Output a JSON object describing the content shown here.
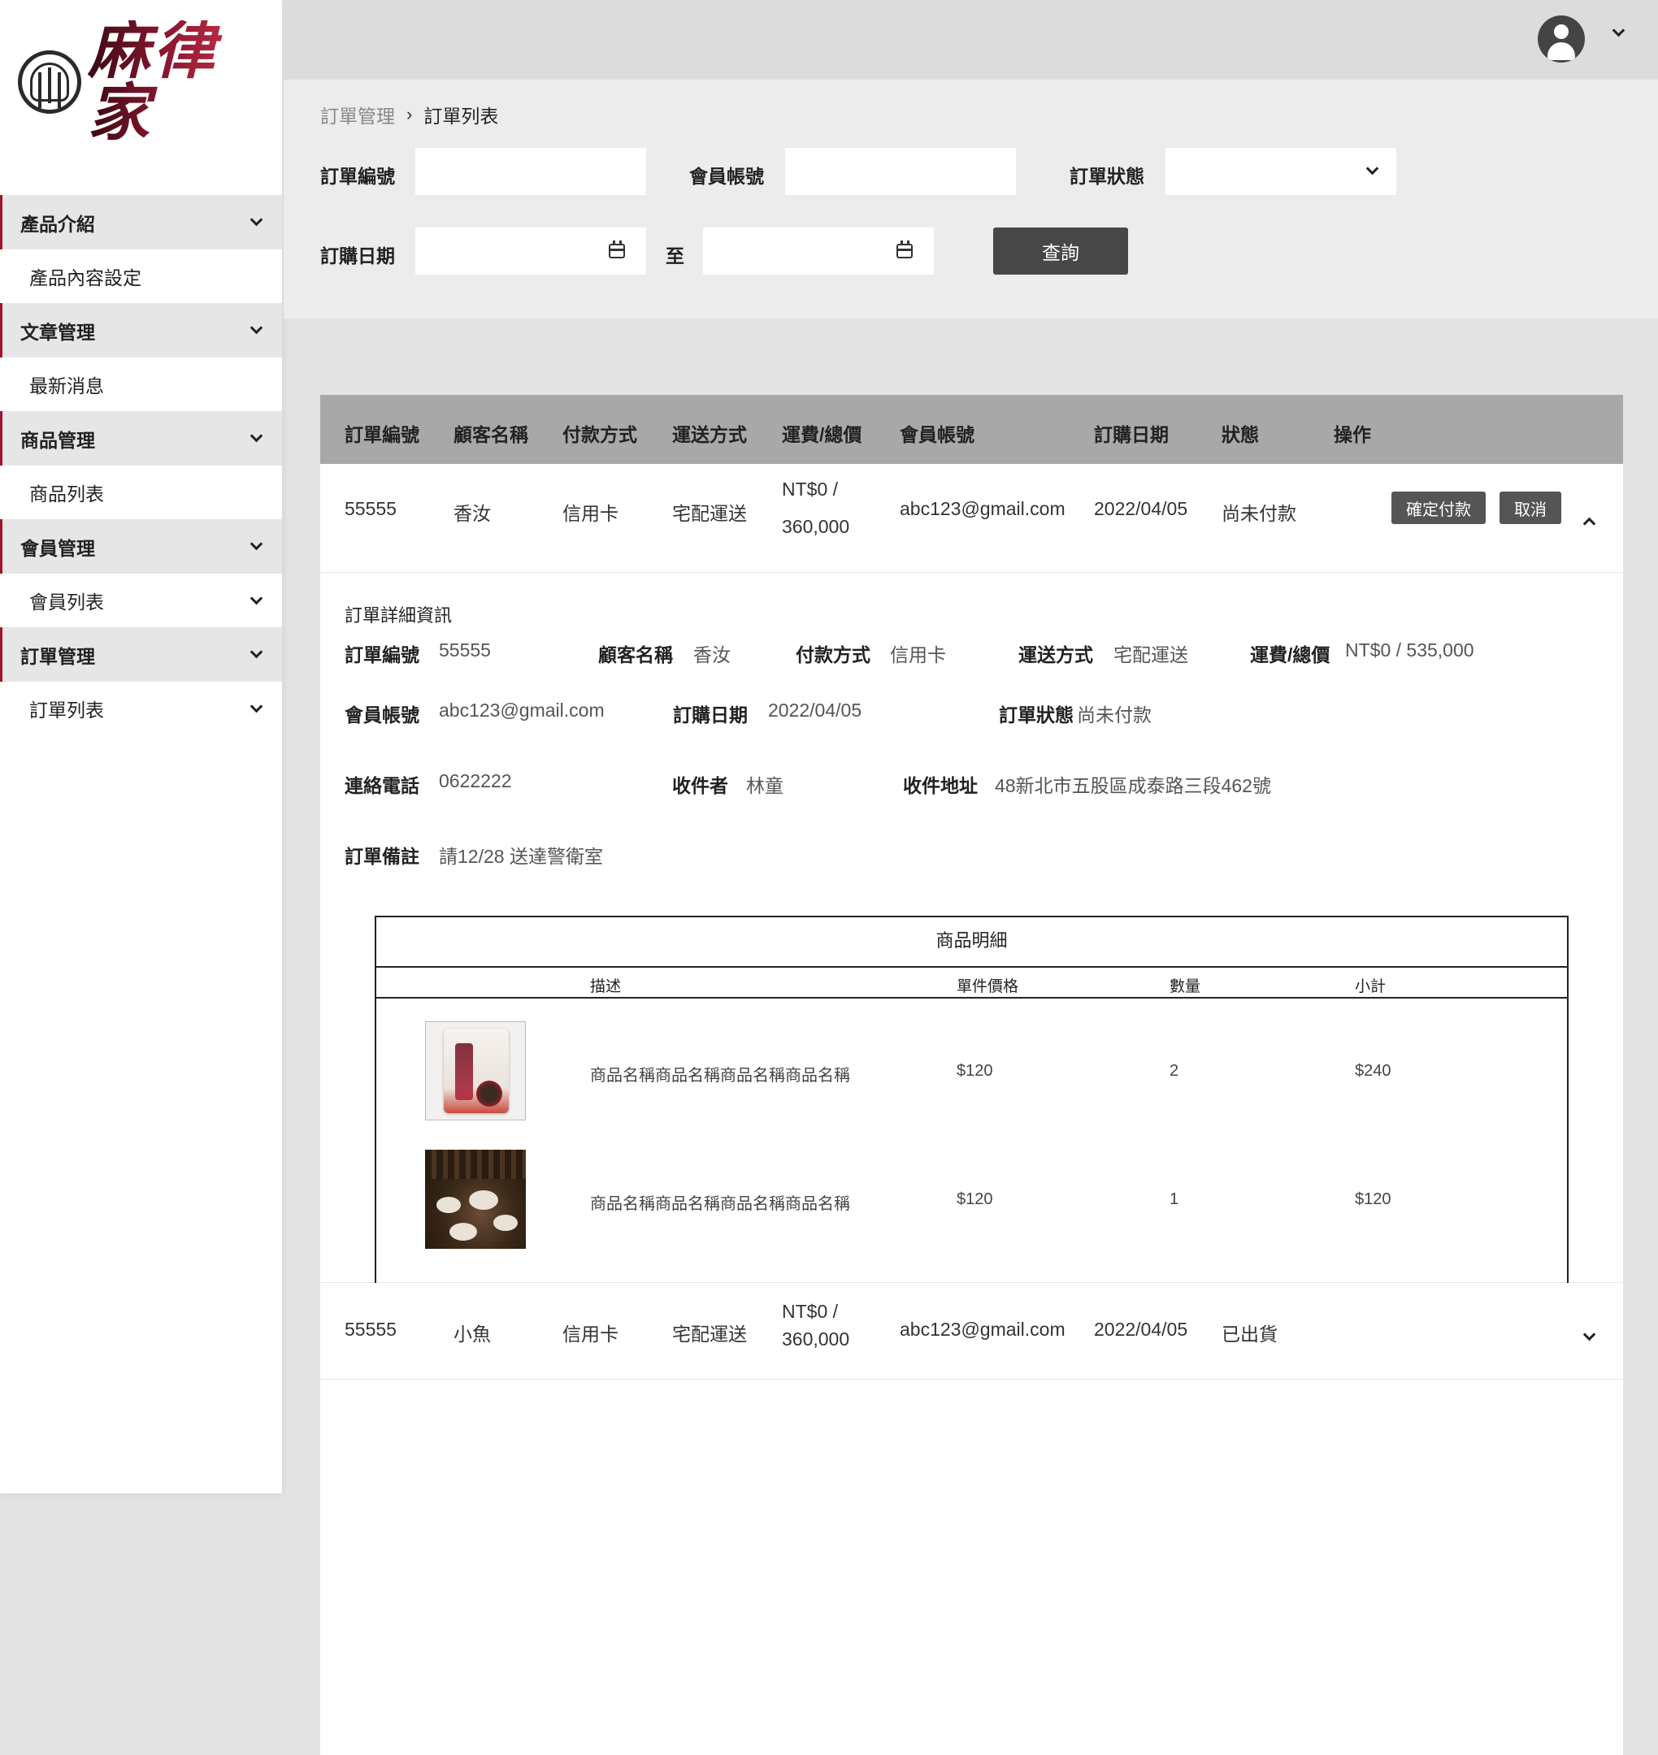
{
  "logo": {
    "text": "麻律家"
  },
  "sidebar": {
    "groups": [
      {
        "label": "產品介紹",
        "items": [
          {
            "label": "產品內容設定",
            "has_caret": false
          }
        ]
      },
      {
        "label": "文章管理",
        "items": [
          {
            "label": "最新消息",
            "has_caret": false
          }
        ]
      },
      {
        "label": "商品管理",
        "items": [
          {
            "label": "商品列表",
            "has_caret": false
          }
        ]
      },
      {
        "label": "會員管理",
        "items": [
          {
            "label": "會員列表",
            "has_caret": true
          }
        ]
      },
      {
        "label": "訂單管理",
        "items": [
          {
            "label": "訂單列表",
            "has_caret": true
          }
        ]
      }
    ]
  },
  "header": {
    "avatar_icon": "user-avatar-icon"
  },
  "breadcrumb": {
    "parent": "訂單管理",
    "separator": "›",
    "current": "訂單列表"
  },
  "filters": {
    "order_no_label": "訂單編號",
    "order_no_value": "",
    "member_label": "會員帳號",
    "member_value": "",
    "status_label": "訂單狀態",
    "status_value": "",
    "date_label": "訂購日期",
    "date_from": "",
    "date_to": "",
    "date_sep": "至",
    "query_button": "查詢"
  },
  "table": {
    "columns": [
      "訂單編號",
      "顧客名稱",
      "付款方式",
      "運送方式",
      "運費/總價",
      "會員帳號",
      "訂購日期",
      "狀態",
      "操作"
    ],
    "rows": [
      {
        "order_no": "55555",
        "customer": "香汝",
        "payment": "信用卡",
        "shipping": "宅配運送",
        "fee_line1": "NT$0 /",
        "fee_line2": "360,000",
        "member": "abc123@gmail.com",
        "date": "2022/04/05",
        "status": "尚未付款",
        "confirm_button": "確定付款",
        "cancel_button": "取消",
        "expanded": true
      },
      {
        "order_no": "55555",
        "customer": "小魚",
        "payment": "信用卡",
        "shipping": "宅配運送",
        "fee_line1": "NT$0 /",
        "fee_line2": "360,000",
        "member": "abc123@gmail.com",
        "date": "2022/04/05",
        "status": "已出貨",
        "expanded": false
      }
    ]
  },
  "detail": {
    "title": "訂單詳細資訊",
    "order_no_label": "訂單編號",
    "order_no": "55555",
    "customer_label": "顧客名稱",
    "customer": "香汝",
    "payment_label": "付款方式",
    "payment": "信用卡",
    "shipping_label": "運送方式",
    "shipping": "宅配運送",
    "fee_label": "運費/總價",
    "fee": "NT$0 / 535,000",
    "member_label": "會員帳號",
    "member": "abc123@gmail.com",
    "date_label": "訂購日期",
    "date": "2022/04/05",
    "status_label": "訂單狀態",
    "status": "尚未付款",
    "phone_label": "連絡電話",
    "phone": "0622222",
    "receiver_label": "收件者",
    "receiver": "林童",
    "address_label": "收件地址",
    "address": "48新北市五股區成泰路三段462號",
    "note_label": "訂單備註",
    "note": "請12/28 送達警衛室"
  },
  "goods": {
    "title": "商品明細",
    "columns": [
      "描述",
      "單件價格",
      "數量",
      "小計"
    ],
    "items": [
      {
        "name": "商品名稱商品名稱商品名稱商品名稱",
        "price": "$120",
        "qty": "2",
        "subtotal": "$240"
      },
      {
        "name": "商品名稱商品名稱商品名稱商品名稱",
        "price": "$120",
        "qty": "1",
        "subtotal": "$120"
      }
    ]
  },
  "colors": {
    "accent": "#a3142c",
    "header_gray": "#a8a8a8",
    "button_dark": "#474747"
  }
}
